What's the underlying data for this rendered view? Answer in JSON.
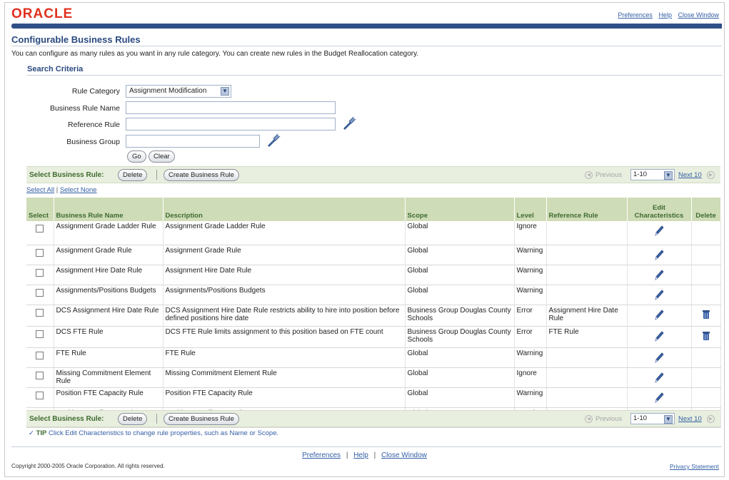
{
  "header": {
    "logo": "ORACLE",
    "links": [
      "Preferences",
      "Help",
      "Close Window"
    ]
  },
  "page": {
    "title": "Configurable Business Rules",
    "instructions": "You can configure as many rules as you want in any rule category. You can create new rules in the Budget Reallocation category."
  },
  "search": {
    "section_title": "Search Criteria",
    "rule_category_label": "Rule Category",
    "rule_category_value": "Assignment Modification",
    "business_rule_name_label": "Business Rule Name",
    "business_rule_name_value": "",
    "reference_rule_label": "Reference Rule",
    "reference_rule_value": "",
    "business_group_label": "Business Group",
    "business_group_value": "",
    "go_label": "Go",
    "clear_label": "Clear"
  },
  "controls": {
    "select_label": "Select Business Rule:",
    "delete_label": "Delete",
    "create_label": "Create Business Rule",
    "previous_label": "Previous",
    "range_value": "1-10",
    "next_label": "Next 10",
    "select_all": "Select All",
    "select_none": "Select None"
  },
  "table": {
    "columns": [
      "Select",
      "Business Rule Name",
      "Description",
      "Scope",
      "Level",
      "Reference Rule",
      "Edit Characteristics",
      "Delete"
    ],
    "rows": [
      {
        "name": "Assignment Grade Ladder Rule",
        "description": "Assignment Grade Ladder Rule",
        "scope": "Global",
        "level": "Ignore",
        "reference": "",
        "deletable": false
      },
      {
        "name": "Assignment Grade Rule",
        "description": "Assignment Grade Rule",
        "scope": "Global",
        "level": "Warning",
        "reference": "",
        "deletable": false
      },
      {
        "name": "Assignment Hire Date Rule",
        "description": "Assignment Hire Date Rule",
        "scope": "Global",
        "level": "Warning",
        "reference": "",
        "deletable": false
      },
      {
        "name": "Assignments/Positions Budgets",
        "description": "Assignments/Positions Budgets",
        "scope": "Global",
        "level": "Warning",
        "reference": "",
        "deletable": false
      },
      {
        "name": "DCS Assignment Hire Date Rule",
        "description": "DCS Assignment Hire Date Rule restricts ability to hire into position before defined positions hire date",
        "scope": "Business Group Douglas County Schools",
        "level": "Error",
        "reference": "Assignment Hire Date Rule",
        "deletable": true
      },
      {
        "name": "DCS FTE Rule",
        "description": "DCS FTE Rule limits assignment to this position based on FTE count",
        "scope": "Business Group Douglas County Schools",
        "level": "Error",
        "reference": "FTE Rule",
        "deletable": true
      },
      {
        "name": "FTE Rule",
        "description": "FTE Rule",
        "scope": "Global",
        "level": "Warning",
        "reference": "",
        "deletable": false
      },
      {
        "name": "Missing Commitment Element Rule",
        "description": "Missing Commitment Element Rule",
        "scope": "Global",
        "level": "Ignore",
        "reference": "",
        "deletable": false
      },
      {
        "name": "Position FTE Capacity Rule",
        "description": "Position FTE Capacity Rule",
        "scope": "Global",
        "level": "Warning",
        "reference": "",
        "deletable": false
      },
      {
        "name": "Position Layoff Date Rule",
        "description": "Position Layoff Date Rule",
        "scope": "Global",
        "level": "Warning",
        "reference": "",
        "deletable": false
      }
    ]
  },
  "tip": {
    "prefix": "TIP",
    "text": "Click Edit Characteristics to change rule properties, such as Name or Scope."
  },
  "footer": {
    "links": [
      "Preferences",
      "Help",
      "Close Window"
    ],
    "separator": "|",
    "copyright": "Copyright 2000-2005 Oracle Corporation. All rights reserved.",
    "privacy": "Privacy Statement"
  },
  "colors": {
    "brand_red": "#e0301e",
    "brand_blue": "#2f4f87",
    "header_green": "#cfdcb8",
    "link_blue": "#335fa5"
  }
}
